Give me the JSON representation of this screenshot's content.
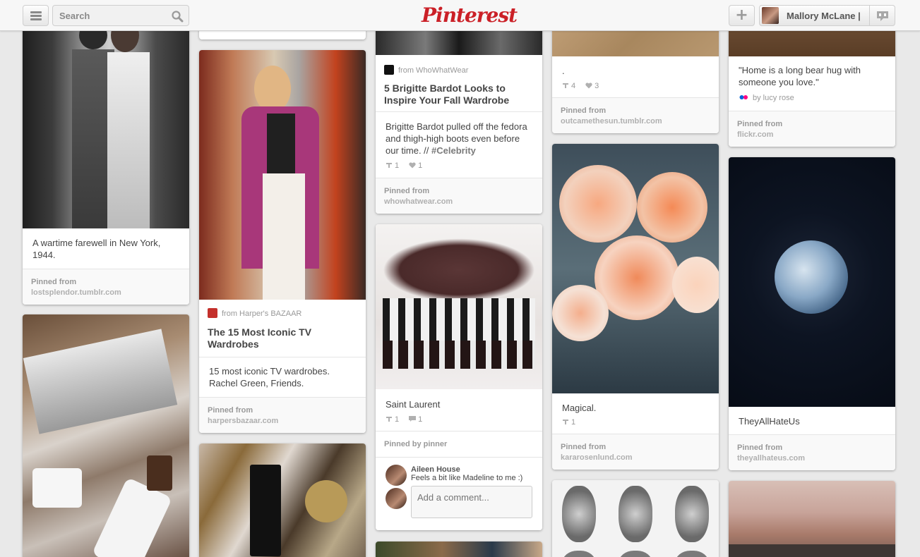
{
  "header": {
    "search_placeholder": "Search",
    "logo": "Pinterest",
    "user_name": "Mallory McLane |"
  },
  "columns": [
    {
      "pins": [
        {
          "description": "A wartime farewell in New York, 1944.",
          "source_label": "Pinned from",
          "source_url": "lostsplendor.tumblr.com"
        },
        {}
      ]
    },
    {
      "pins": [
        {
          "from_text": "from Harper's BAZAAR",
          "title": "The 15 Most Iconic TV Wardrobes",
          "description": "15 most iconic TV wardrobes. Rachel Green, Friends.",
          "source_label": "Pinned from",
          "source_url": "harpersbazaar.com"
        },
        {}
      ]
    },
    {
      "pins": [
        {
          "from_text": "from WhoWhatWear",
          "title": "5 Brigitte Bardot Looks to Inspire Your Fall Wardrobe",
          "description": "Brigitte Bardot pulled off the fedora and thigh-high boots even before our time. // ",
          "tag": "#Celebrity",
          "repins": "1",
          "likes": "1",
          "source_label": "Pinned from",
          "source_url": "whowhatwear.com"
        },
        {
          "description": "Saint Laurent",
          "repins": "1",
          "comments": "1",
          "pinned_by": "Pinned by pinner",
          "comment_author": "Aileen House",
          "comment_text": "Feels a bit like Madeline to me :)",
          "comment_placeholder": "Add a comment..."
        }
      ]
    },
    {
      "pins": [
        {
          "description": ".",
          "repins": "4",
          "likes": "3",
          "source_label": "Pinned from",
          "source_url": "outcamethesun.tumblr.com"
        },
        {
          "description": "Magical.",
          "repins": "1",
          "source_label": "Pinned from",
          "source_url": "kararosenlund.com"
        },
        {}
      ]
    },
    {
      "pins": [
        {
          "description": "\"Home is a long bear hug with someone you love.\"",
          "by_text": "by lucy rose",
          "source_label": "Pinned from",
          "source_url": "flickr.com"
        },
        {
          "description": "TheyAllHateUs",
          "source_label": "Pinned from",
          "source_url": "theyallhateus.com"
        },
        {}
      ]
    }
  ],
  "colors": {
    "brand": "#cb2027",
    "background": "#e9e9e9"
  },
  "icons": [
    "menu-icon",
    "search-icon",
    "plus-icon",
    "notification-icon",
    "repin-icon",
    "heart-icon",
    "comment-icon",
    "flickr-icon"
  ]
}
